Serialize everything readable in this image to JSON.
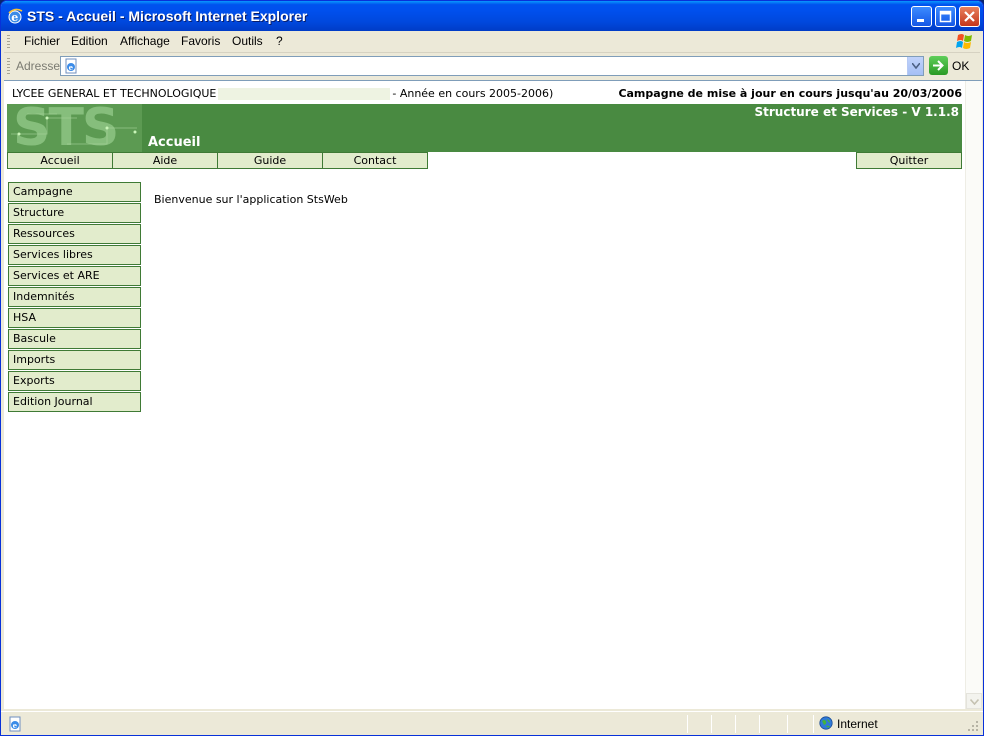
{
  "window": {
    "title": "STS - Accueil - Microsoft Internet Explorer"
  },
  "menubar": {
    "items": [
      "Fichier",
      "Edition",
      "Affichage",
      "Favoris",
      "Outils",
      "?"
    ]
  },
  "addressbar": {
    "label": "Adresse",
    "value": "",
    "go_label": "OK"
  },
  "page": {
    "school_prefix": "LYCEE GENERAL ET TECHNOLOGIQUE",
    "school_suffix": "- Année en cours 2005-2006)",
    "campaign_notice": "Campagne de mise à jour en cours jusqu'au 20/03/2006",
    "logo_text": "STS",
    "app_subtitle": "Structure et Services - V 1.1.8",
    "heading": "Accueil",
    "topnav": {
      "accueil": "Accueil",
      "aide": "Aide",
      "guide": "Guide",
      "contact": "Contact",
      "quitter": "Quitter"
    },
    "side_menu": [
      "Campagne",
      "Structure",
      "Ressources",
      "Services libres",
      "Services et ARE",
      "Indemnités",
      "HSA",
      "Bascule",
      "Imports",
      "Exports",
      "Edition Journal"
    ],
    "welcome": "Bienvenue sur l'application StsWeb"
  },
  "statusbar": {
    "zone": "Internet"
  },
  "colors": {
    "banner_green": "#498a41",
    "menu_bg": "#e2eccc",
    "menu_border": "#3f7a35",
    "titlebar_blue": "#0053ee"
  }
}
